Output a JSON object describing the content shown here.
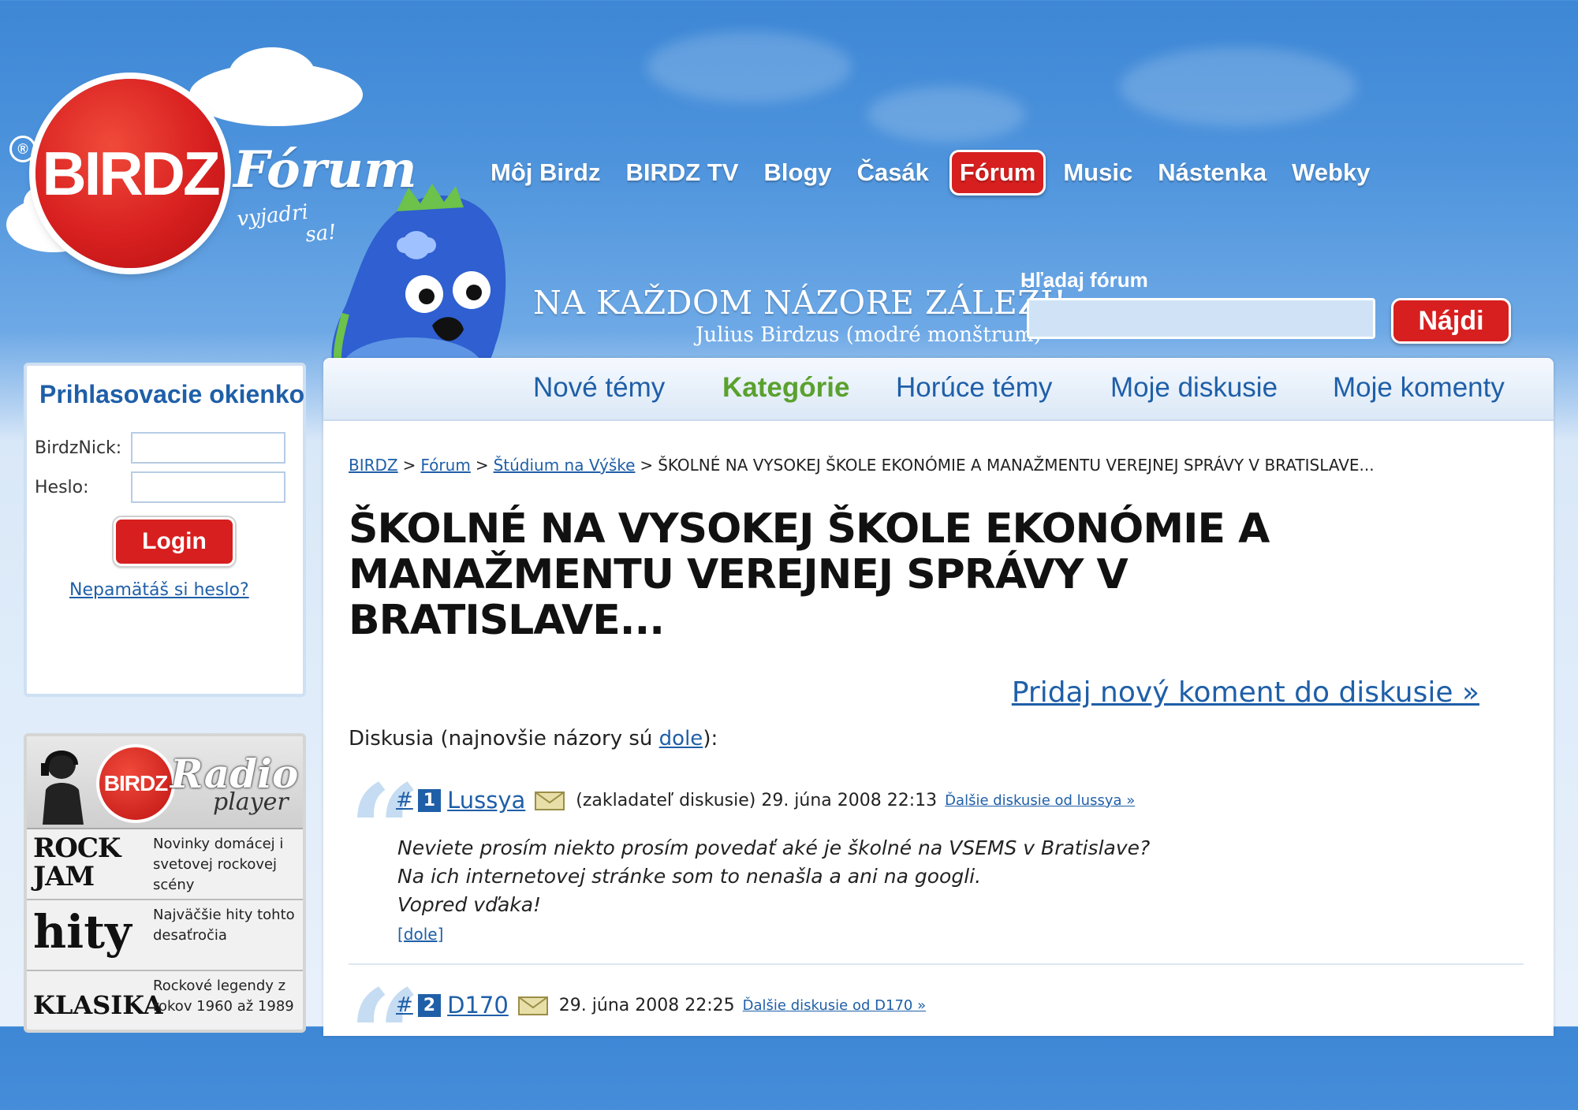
{
  "logo": {
    "brand": "BIRDZ",
    "reg": "®",
    "section": "Fórum",
    "tagline_1": "vyjadri",
    "tagline_2": "sa!"
  },
  "topnav": [
    "Môj Birdz",
    "BIRDZ TV",
    "Blogy",
    "Časák",
    "Fórum",
    "Music",
    "Nástenka",
    "Webky"
  ],
  "topnav_active": "Fórum",
  "slogan": {
    "main": "NA KAŽDOM NÁZORE ZÁLEŽÍ!",
    "sub": "Julius Birdzus (modré monštrum)"
  },
  "search": {
    "label": "Hľadaj fórum",
    "value": "",
    "button": "Nájdi"
  },
  "tabs": [
    "Nové témy",
    "Kategórie",
    "Horúce témy",
    "Moje diskusie",
    "Moje komenty"
  ],
  "tabs_active": "Kategórie",
  "login": {
    "title": "Prihlasovacie okienko",
    "nick_label": "BirdzNick:",
    "pass_label": "Heslo:",
    "button": "Login",
    "forgot": "Nepamätáš si heslo?"
  },
  "radio": {
    "brand": "BIRDZ",
    "title": "Radio",
    "subtitle": "player",
    "rows": [
      {
        "name": "ROCK JAM",
        "desc": "Novinky domácej i svetovej rockovej scény"
      },
      {
        "name": "hity",
        "desc": "Najväčšie hity tohto desaťročia"
      },
      {
        "name": "KLASIKA",
        "desc": "Rockové legendy z rokov 1960 až 1989"
      }
    ]
  },
  "breadcrumb": [
    "BIRDZ",
    "Fórum",
    "Štúdium na Výške",
    "ŠKOLNÉ NA VYSOKEJ ŠKOLE EKONÓMIE A MANAŽMENTU VEREJNEJ SPRÁVY V BRATISLAVE..."
  ],
  "title": "ŠKOLNÉ NA VYSOKEJ ŠKOLE EKONÓMIE A MANAŽMENTU VEREJNEJ SPRÁVY V BRATISLAVE...",
  "add_comment": "Pridaj nový koment do diskusie »",
  "discussion_intro": {
    "before": "Diskusia (najnovšie názory sú ",
    "link": "dole",
    "after": "):"
  },
  "posts": [
    {
      "hash": "#",
      "num": "1",
      "user": "Lussya",
      "meta": "(zakladateľ diskusie) 29. júna 2008 22:13",
      "more": "Ďalšie diskusie od lussya »",
      "lines": [
        "Neviete prosím niekto prosím povedať aké je školné na VSEMS v Bratislave?",
        "Na ich internetovej stránke som to nenašla a ani na googli.",
        "Vopred vďaka!"
      ],
      "down": "[dole]"
    },
    {
      "hash": "#",
      "num": "2",
      "user": "D170",
      "meta": "29. júna 2008 22:25",
      "more": "Ďalšie diskusie od D170 »"
    }
  ],
  "colors": {
    "red": "#d71f1f",
    "blue_link": "#1f5fa8",
    "green_active": "#5aa12e",
    "sky": "#4d93dc"
  }
}
